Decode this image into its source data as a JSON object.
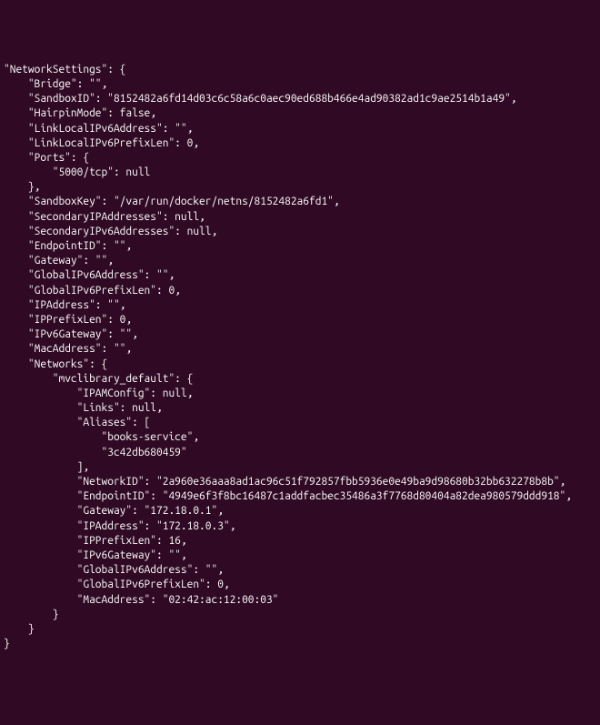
{
  "lines": [
    "\"NetworkSettings\": {",
    "    \"Bridge\": \"\",",
    "    \"SandboxID\": \"8152482a6fd14d03c6c58a6c0aec90ed688b466e4ad90382ad1c9ae2514b1a49\",",
    "    \"HairpinMode\": false,",
    "    \"LinkLocalIPv6Address\": \"\",",
    "    \"LinkLocalIPv6PrefixLen\": 0,",
    "    \"Ports\": {",
    "        \"5000/tcp\": null",
    "    },",
    "    \"SandboxKey\": \"/var/run/docker/netns/8152482a6fd1\",",
    "    \"SecondaryIPAddresses\": null,",
    "    \"SecondaryIPv6Addresses\": null,",
    "    \"EndpointID\": \"\",",
    "    \"Gateway\": \"\",",
    "    \"GlobalIPv6Address\": \"\",",
    "    \"GlobalIPv6PrefixLen\": 0,",
    "    \"IPAddress\": \"\",",
    "    \"IPPrefixLen\": 0,",
    "    \"IPv6Gateway\": \"\",",
    "    \"MacAddress\": \"\",",
    "    \"Networks\": {",
    "        \"mvclibrary_default\": {",
    "            \"IPAMConfig\": null,",
    "            \"Links\": null,",
    "            \"Aliases\": [",
    "                \"books-service\",",
    "                \"3c42db680459\"",
    "            ],",
    "            \"NetworkID\": \"2a960e36aaa8ad1ac96c51f792857fbb5936e0e49ba9d98680b32bb632278b8b\",",
    "            \"EndpointID\": \"4949e6f3f8bc16487c1addfacbec35486a3f7768d80404a82dea980579ddd918\",",
    "            \"Gateway\": \"172.18.0.1\",",
    "            \"IPAddress\": \"172.18.0.3\",",
    "            \"IPPrefixLen\": 16,",
    "            \"IPv6Gateway\": \"\",",
    "            \"GlobalIPv6Address\": \"\",",
    "            \"GlobalIPv6PrefixLen\": 0,",
    "            \"MacAddress\": \"02:42:ac:12:00:03\"",
    "        }",
    "    }",
    "}"
  ]
}
